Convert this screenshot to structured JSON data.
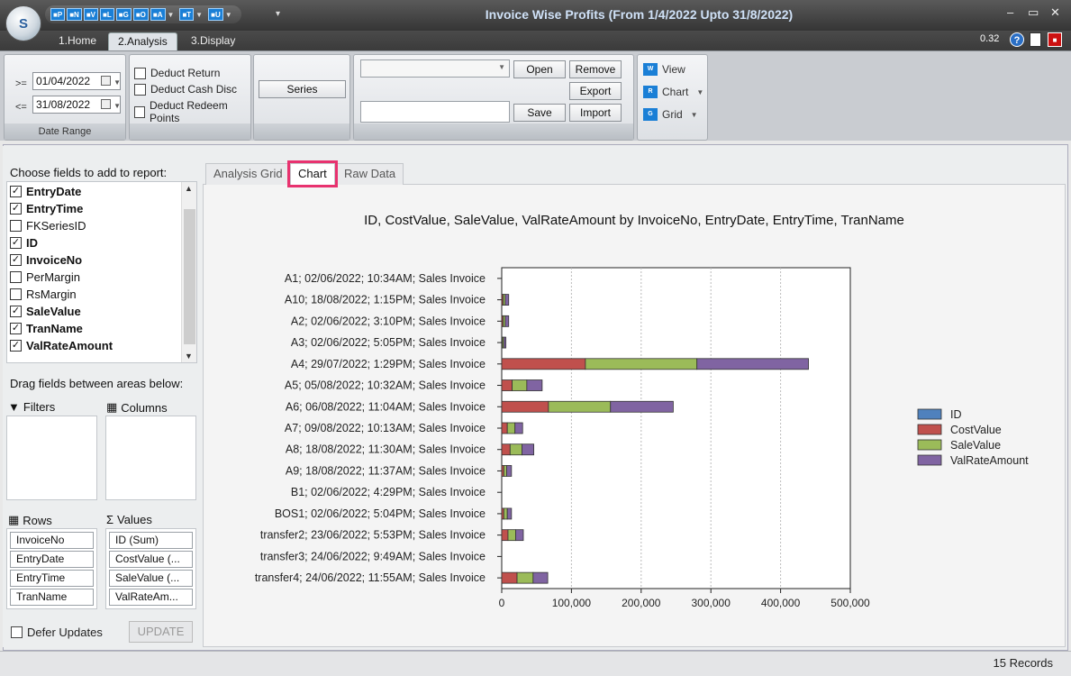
{
  "window": {
    "title": "Invoice Wise Profits (From 1/4/2022 Upto 31/8/2022)",
    "version": "0.32",
    "minimize": "–",
    "maximize": "▭",
    "close": "✕"
  },
  "app_logo": "S",
  "quick_access": [
    "P",
    "N",
    "V",
    "L",
    "G",
    "O",
    "A",
    "T",
    "U"
  ],
  "ribbon_tabs": [
    "1.Home",
    "2.Analysis",
    "3.Display"
  ],
  "date_range": {
    "ge_label": ">=",
    "le_label": "<=",
    "from": "01/04/2022",
    "to": "31/08/2022",
    "footer": "Date Range"
  },
  "deductions": [
    "Deduct Return",
    "Deduct Cash Disc",
    "Deduct Redeem Points"
  ],
  "series_button": "Series",
  "layout_buttons": {
    "open": "Open",
    "remove": "Remove",
    "export": "Export",
    "save": "Save",
    "import": "Import"
  },
  "display_buttons": {
    "view": "View",
    "chart": "Chart",
    "grid": "Grid",
    "view_icon": "W",
    "chart_icon": "R",
    "grid_icon": "G"
  },
  "left_panel": {
    "choose_title": "Choose fields to add to report:",
    "fields": [
      {
        "name": "EntryDate",
        "checked": true
      },
      {
        "name": "EntryTime",
        "checked": true
      },
      {
        "name": "FKSeriesID",
        "checked": false
      },
      {
        "name": "ID",
        "checked": true
      },
      {
        "name": "InvoiceNo",
        "checked": true
      },
      {
        "name": "PerMargin",
        "checked": false
      },
      {
        "name": "RsMargin",
        "checked": false
      },
      {
        "name": "SaleValue",
        "checked": true
      },
      {
        "name": "TranName",
        "checked": true
      },
      {
        "name": "ValRateAmount",
        "checked": true
      }
    ],
    "drag_title": "Drag fields between areas below:",
    "filters_label": "Filters",
    "columns_label": "Columns",
    "rows_label": "Rows",
    "values_label": "Values",
    "rows": [
      "InvoiceNo",
      "EntryDate",
      "EntryTime",
      "TranName"
    ],
    "values": [
      "ID (Sum)",
      "CostValue (...",
      "SaleValue (...",
      "ValRateAm..."
    ],
    "defer_updates": "Defer Updates",
    "update_button": "UPDATE"
  },
  "content_tabs": [
    "Analysis Grid",
    "Chart",
    "Raw Data"
  ],
  "status": {
    "records": "15 Records"
  },
  "chart_data": {
    "type": "bar",
    "orientation": "horizontal",
    "stacked": true,
    "title": "ID, CostValue, SaleValue, ValRateAmount by InvoiceNo, EntryDate, EntryTime, TranName",
    "categories": [
      "A1; 02/06/2022; 10:34AM; Sales Invoice",
      "A10; 18/08/2022; 1:15PM; Sales Invoice",
      "A2; 02/06/2022; 3:10PM; Sales Invoice",
      "A3; 02/06/2022; 5:05PM; Sales Invoice",
      "A4; 29/07/2022; 1:29PM; Sales Invoice",
      "A5; 05/08/2022; 10:32AM; Sales Invoice",
      "A6; 06/08/2022; 11:04AM; Sales Invoice",
      "A7; 09/08/2022; 10:13AM; Sales Invoice",
      "A8; 18/08/2022; 11:30AM; Sales Invoice",
      "A9; 18/08/2022; 11:37AM; Sales Invoice",
      "B1; 02/06/2022; 4:29PM; Sales Invoice",
      "BOS1; 02/06/2022; 5:04PM; Sales Invoice",
      "transfer2; 23/06/2022; 5:53PM; Sales Invoice",
      "transfer3; 24/06/2022; 9:49AM; Sales Invoice",
      "transfer4; 24/06/2022; 11:55AM; Sales Invoice"
    ],
    "series": [
      {
        "name": "ID",
        "color": "#4f81bd",
        "values": [
          0,
          0,
          0,
          0,
          0,
          0,
          0,
          0,
          0,
          0,
          0,
          0,
          0,
          0,
          0
        ]
      },
      {
        "name": "CostValue",
        "color": "#c0504d",
        "values": [
          0,
          2000,
          2000,
          1000,
          120000,
          15000,
          67000,
          8000,
          12000,
          3000,
          0,
          3000,
          9000,
          0,
          22000
        ]
      },
      {
        "name": "SaleValue",
        "color": "#9bbb59",
        "values": [
          0,
          3000,
          3000,
          2000,
          160000,
          21000,
          89000,
          11000,
          17000,
          4000,
          0,
          5000,
          11000,
          0,
          23000
        ]
      },
      {
        "name": "ValRateAmount",
        "color": "#8064a2",
        "values": [
          0,
          5000,
          5000,
          3000,
          160000,
          22000,
          90000,
          11000,
          17000,
          7000,
          0,
          6000,
          11000,
          0,
          21000
        ]
      }
    ],
    "x_ticks": [
      "0",
      "100,000",
      "200,000",
      "300,000",
      "400,000",
      "500,000"
    ],
    "xlim": [
      0,
      500000
    ],
    "grid": "vertical dotted",
    "legend": "right"
  }
}
